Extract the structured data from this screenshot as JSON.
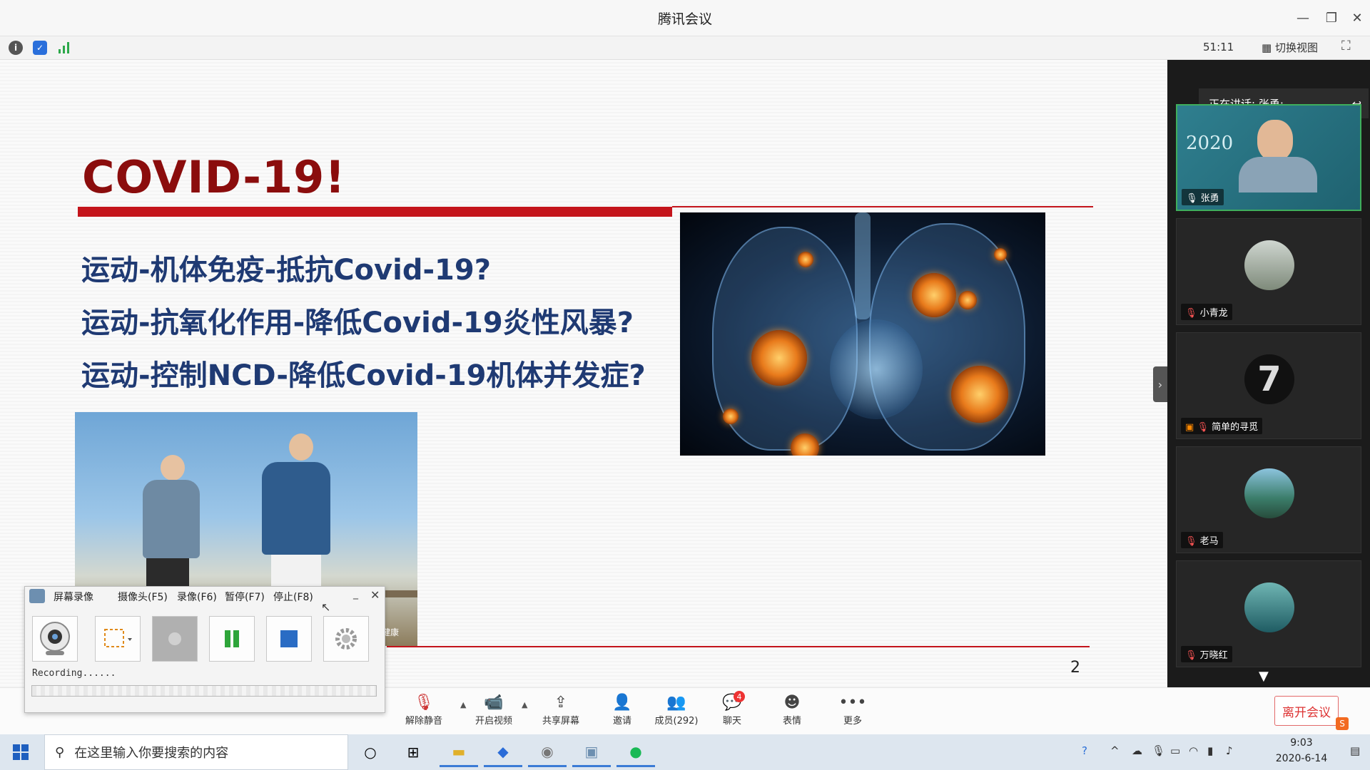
{
  "window": {
    "title": "腾讯会议"
  },
  "infobar": {
    "timer": "51:11",
    "switch_view": "切换视图"
  },
  "slide": {
    "title": "COVID-19!",
    "questions": [
      "运动-机体免疫-抵抗Covid-19?",
      "运动-抗氧化作用-降低Covid-19炎性风暴?",
      "运动-控制NCD-降低Covid-19机体并发症?"
    ],
    "photo_caption": "动健康",
    "page_number": "2"
  },
  "panel": {
    "speaking": "正在讲话: 张勇;",
    "participants": [
      {
        "name": "张勇",
        "muted": false
      },
      {
        "name": "小青龙",
        "muted": true
      },
      {
        "name": "简单的寻觅",
        "muted": true
      },
      {
        "name": "老马",
        "muted": true
      },
      {
        "name": "万晓红",
        "muted": true
      }
    ],
    "speaker_bg_year": "2020"
  },
  "toolbar": {
    "unmute": "解除静音",
    "video": "开启视频",
    "share": "共享屏幕",
    "invite": "邀请",
    "members": "成员(292)",
    "chat": "聊天",
    "chat_badge": "4",
    "reactions": "表情",
    "more": "更多",
    "leave": "离开会议"
  },
  "recorder": {
    "title": "屏幕录像",
    "menu": [
      "摄像头(F5)",
      "录像(F6)",
      "暂停(F7)",
      "停止(F8)"
    ],
    "status": "Recording......"
  },
  "taskbar": {
    "search_placeholder": "在这里输入你要搜索的内容",
    "time": "9:03",
    "date": "2020-6-14"
  },
  "colors": {
    "slide_title": "#8b0d0d",
    "question_text": "#1f3a73",
    "accent_red": "#c4141b",
    "leave_red": "#d33333"
  }
}
